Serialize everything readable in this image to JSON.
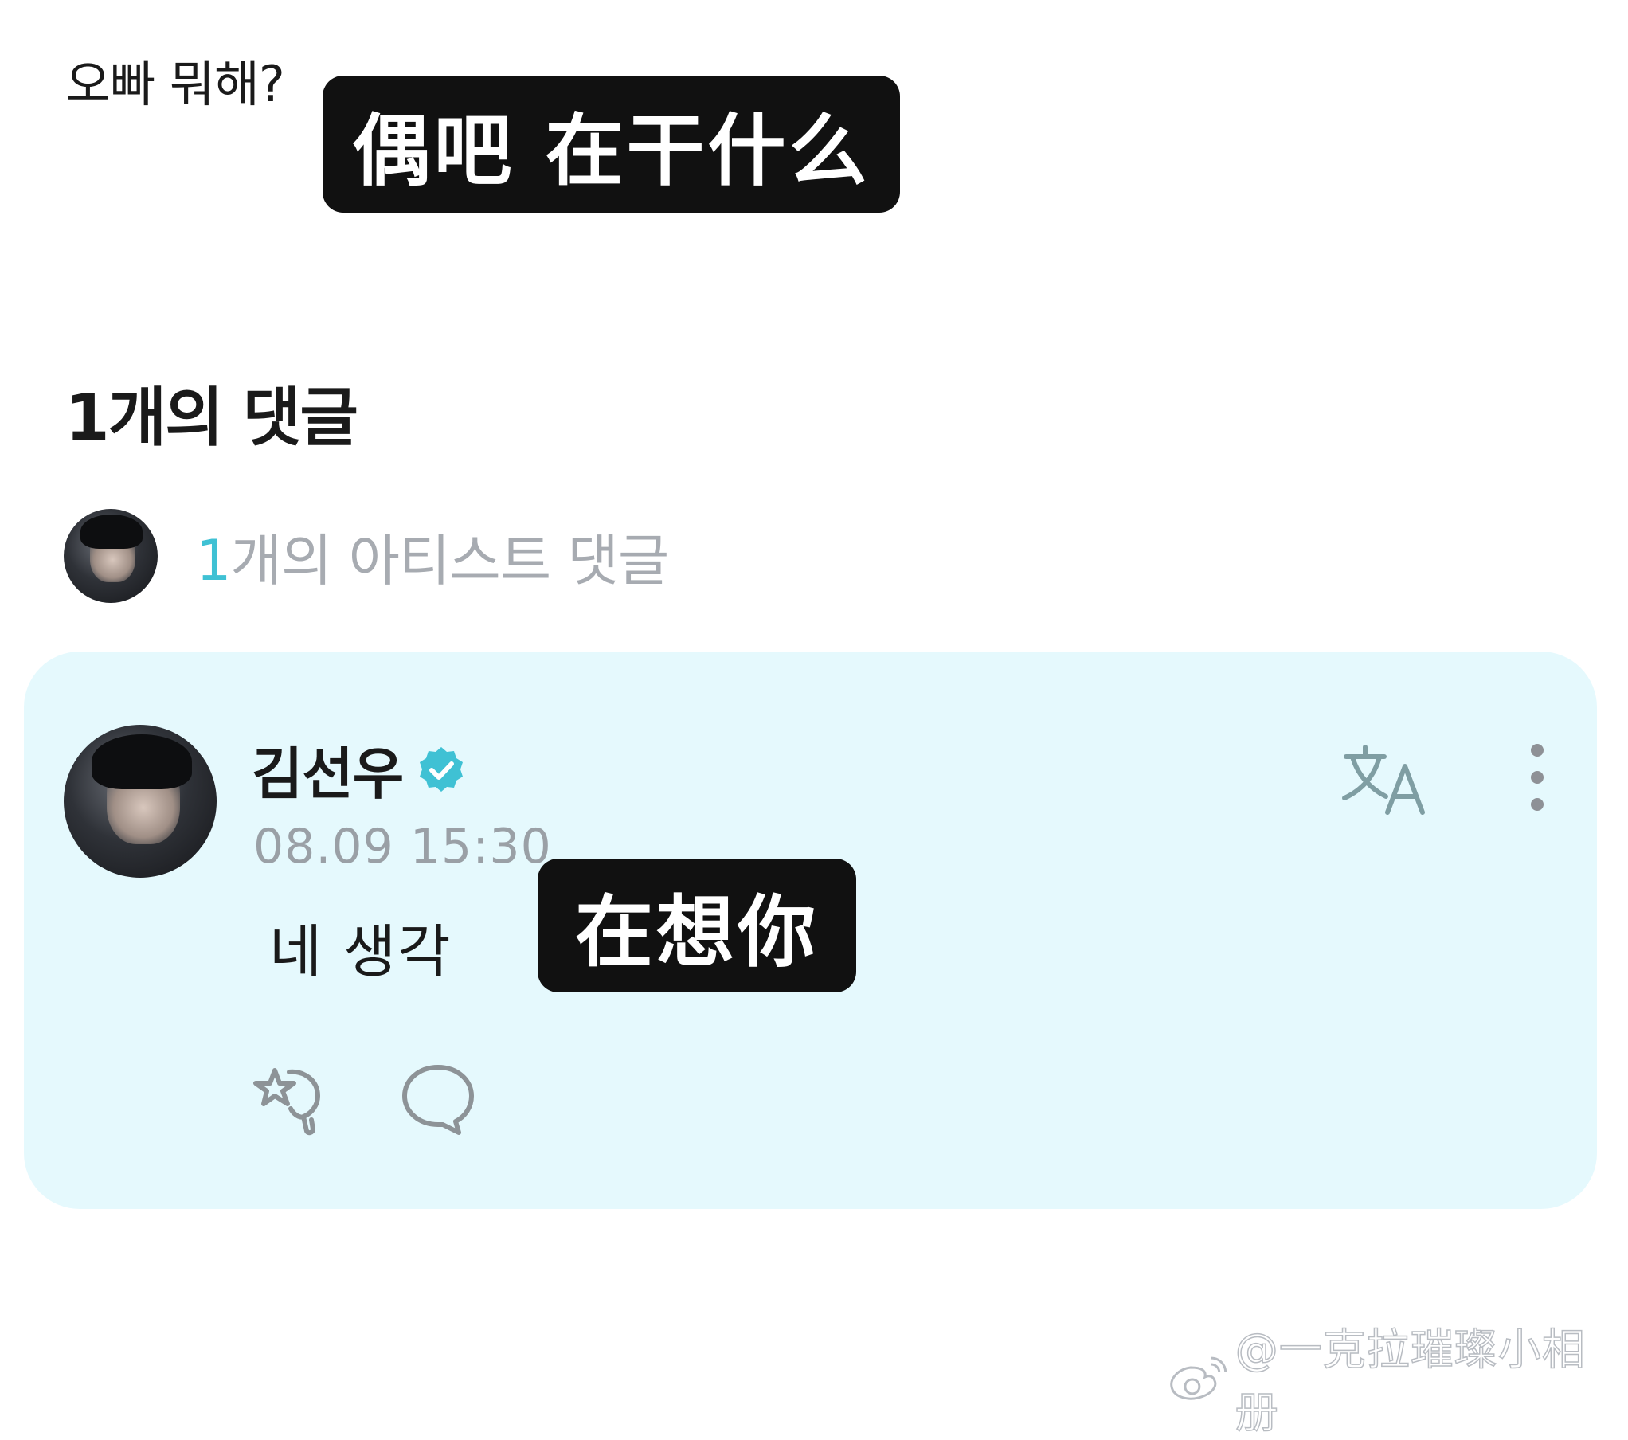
{
  "post": {
    "text": "오빠 뭐해?"
  },
  "captions": {
    "post_translation": "偶吧 在干什么",
    "reply_translation": "在想你"
  },
  "comments": {
    "count_title": "1개의 댓글",
    "artist_summary": {
      "count": "1",
      "label": "개의 아티스트 댓글"
    }
  },
  "comment": {
    "author": "김선우",
    "timestamp": "08.09 15:30",
    "body": "네 생각",
    "verified": true,
    "actions": {
      "translate_icon": "translate-icon",
      "more_icon": "more-vertical-icon",
      "like_icon": "star-like-icon",
      "reply_icon": "speech-bubble-icon"
    }
  },
  "watermark": {
    "text": "@一克拉璀璨小相册",
    "icon": "weibo-icon"
  },
  "colors": {
    "accent": "#3fc1d4",
    "card_background": "#e5f9fd",
    "caption_background": "#111111"
  }
}
